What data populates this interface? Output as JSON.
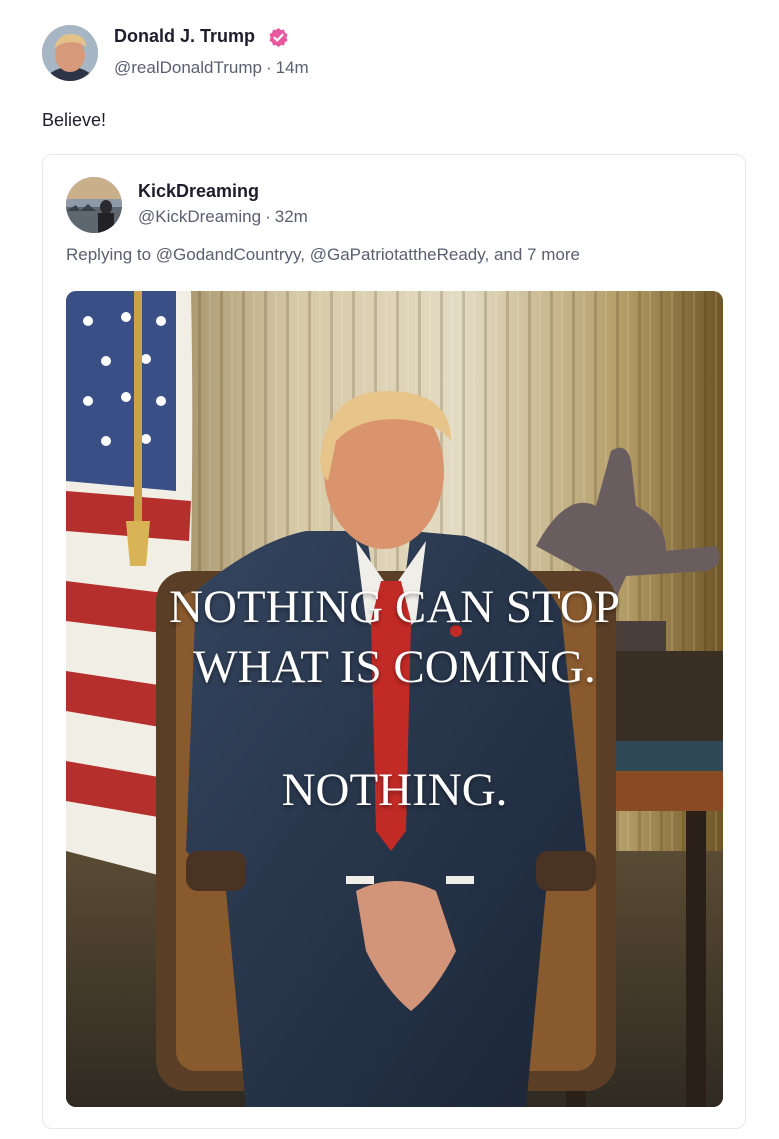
{
  "post": {
    "author": {
      "name": "Donald J. Trump",
      "handle": "@realDonaldTrump",
      "separator": "·",
      "time": "14m",
      "verified": true,
      "verified_color": "#e8589c"
    },
    "text": "Believe!",
    "quoted": {
      "author": {
        "name": "KickDreaming",
        "handle": "@KickDreaming",
        "separator": "·",
        "time": "32m"
      },
      "reply_line": "Replying to @GodandCountryy, @GaPatriotattheReady, and 7 more",
      "media": {
        "lines": [
          "NOTHING CAN STOP",
          "WHAT IS COMING.",
          "NOTHING."
        ]
      }
    }
  }
}
